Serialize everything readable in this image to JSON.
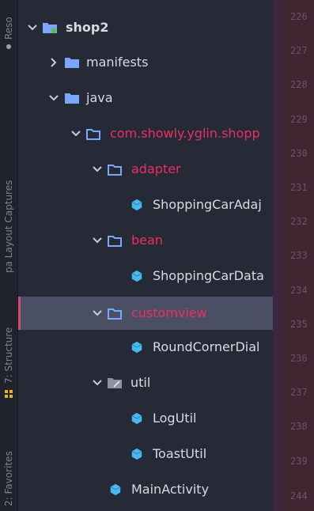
{
  "tool_strip": {
    "resources_label": "Reso",
    "layout_captures_label": "pa Layout Captures",
    "structure_label": "7: Structure",
    "favorites_label": "2: Favorites"
  },
  "tree": {
    "root": "shop2",
    "manifests": "manifests",
    "java": "java",
    "package": "com.showly.yglin.shopp",
    "adapter": "adapter",
    "adapter_class": "ShoppingCarAdaj",
    "bean": "bean",
    "bean_class": "ShoppingCarData",
    "customview": "customview",
    "customview_class": "RoundCornerDial",
    "util": "util",
    "util_class_1": "LogUtil",
    "util_class_2": "ToastUtil",
    "main_class": "MainActivity"
  },
  "gutter": {
    "line_numbers": [
      "226",
      "227",
      "228",
      "229",
      "230",
      "231",
      "232",
      "233",
      "234",
      "235",
      "236",
      "237",
      "238",
      "239",
      "244"
    ]
  },
  "colors": {
    "background": "#262a37",
    "package_text": "#ea2f62",
    "folder_icon": "#7aa7ff",
    "class_icon": "#4ab8f0",
    "selection": "#4b4f63",
    "gutter": "#402631"
  },
  "selected_item": "customview"
}
